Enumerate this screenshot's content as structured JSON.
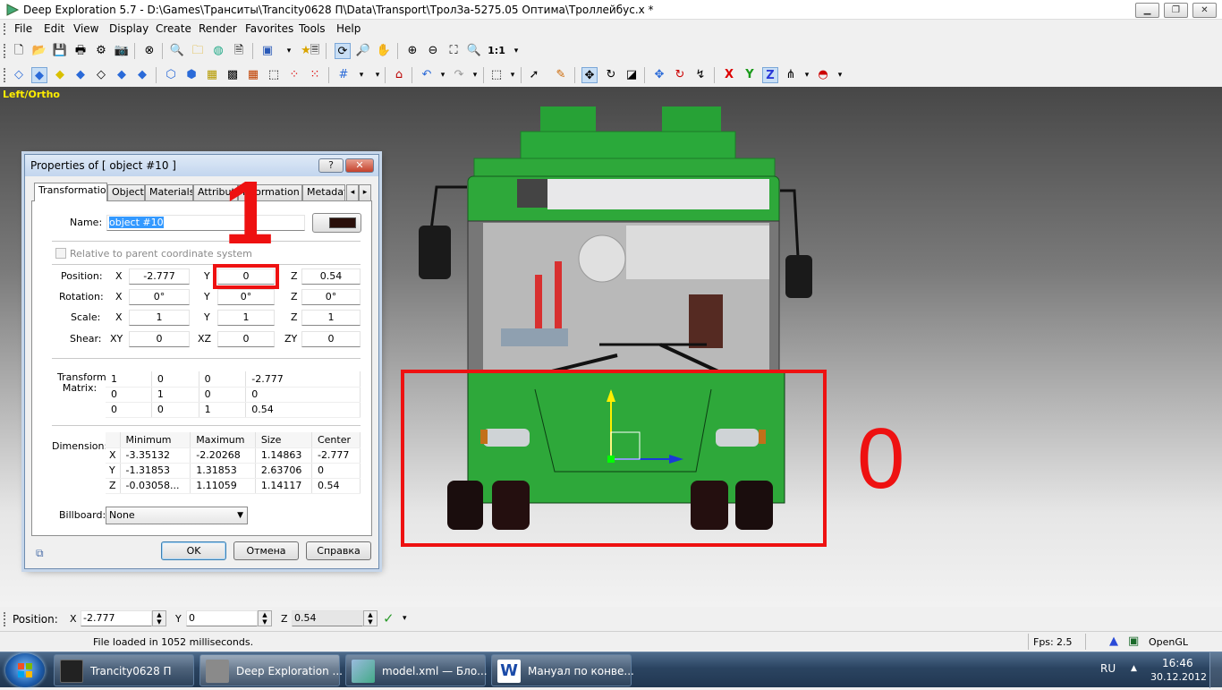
{
  "window": {
    "title": "Deep Exploration 5.7 - D:\\Games\\Транситы\\Trancity0628 П\\Data\\Transport\\ТролЗа-5275.05 Оптима\\Троллейбус.x *",
    "min": "▁",
    "max": "❐",
    "close": "✕"
  },
  "menu": [
    "File",
    "Edit",
    "View",
    "Display",
    "Create",
    "Render",
    "Favorites",
    "Tools",
    "Help"
  ],
  "toolbar1": {
    "zoom_label": "1:1"
  },
  "toolbar2": {
    "axis_x": "X",
    "axis_y": "Y",
    "axis_z": "Z"
  },
  "viewport": {
    "label": "Left/Ortho"
  },
  "annotations": {
    "one": "1",
    "zero": "0"
  },
  "props": {
    "title": "Properties of  [ object #10 ]",
    "help_btn": "?",
    "close_btn": "✕",
    "tabs": [
      "Transformation",
      "Object",
      "Materials",
      "Attributes",
      "Information",
      "Metadata"
    ],
    "name_label": "Name:",
    "name_value": "object #10",
    "relative_label": "Relative to parent coordinate system",
    "position_label": "Position:",
    "rotation_label": "Rotation:",
    "scale_label": "Scale:",
    "shear_label": "Shear:",
    "axes": [
      "X",
      "Y",
      "Z"
    ],
    "shear_axes": [
      "XY",
      "XZ",
      "ZY"
    ],
    "position": [
      "-2.777",
      "0",
      "0.54"
    ],
    "rotation": [
      "0°",
      "0°",
      "0°"
    ],
    "scale": [
      "1",
      "1",
      "1"
    ],
    "shear": [
      "0",
      "0",
      "0"
    ],
    "matrix_label": "Transform Matrix:",
    "matrix": [
      [
        "1",
        "0",
        "0",
        "-2.777"
      ],
      [
        "0",
        "1",
        "0",
        "0"
      ],
      [
        "0",
        "0",
        "1",
        "0.54"
      ]
    ],
    "dimension_label": "Dimension:",
    "dim_headers": [
      "",
      "Minimum",
      "Maximum",
      "Size",
      "Center"
    ],
    "dim_rows": [
      [
        "X",
        "-3.35132",
        "-2.20268",
        "1.14863",
        "-2.777"
      ],
      [
        "Y",
        "-1.31853",
        "1.31853",
        "2.63706",
        "0"
      ],
      [
        "Z",
        "-0.03058...",
        "1.11059",
        "1.14117",
        "0.54"
      ]
    ],
    "billboard_label": "Billboard:",
    "billboard_value": "None",
    "ok": "OK",
    "cancel": "Отмена",
    "help": "Справка"
  },
  "posbar": {
    "label": "Position:",
    "x_label": "X",
    "x": "-2.777",
    "y_label": "Y",
    "y": "0",
    "z_label": "Z",
    "z": "0.54",
    "apply": "✓"
  },
  "status": {
    "message": "File loaded in 1052 milliseconds.",
    "fps_label": "Fps:",
    "fps": "2.5",
    "renderer": "OpenGL"
  },
  "taskbar": {
    "items": [
      "Trancity0628 П",
      "Deep Exploration ...",
      "model.xml — Бло...",
      "Мануал по конве..."
    ],
    "lang": "RU",
    "time": "16:46",
    "date": "30.12.2012"
  },
  "colors": {
    "accent_red": "#ee1111",
    "bus_green": "#2ea83a",
    "status_yellow": "#ffee00"
  }
}
